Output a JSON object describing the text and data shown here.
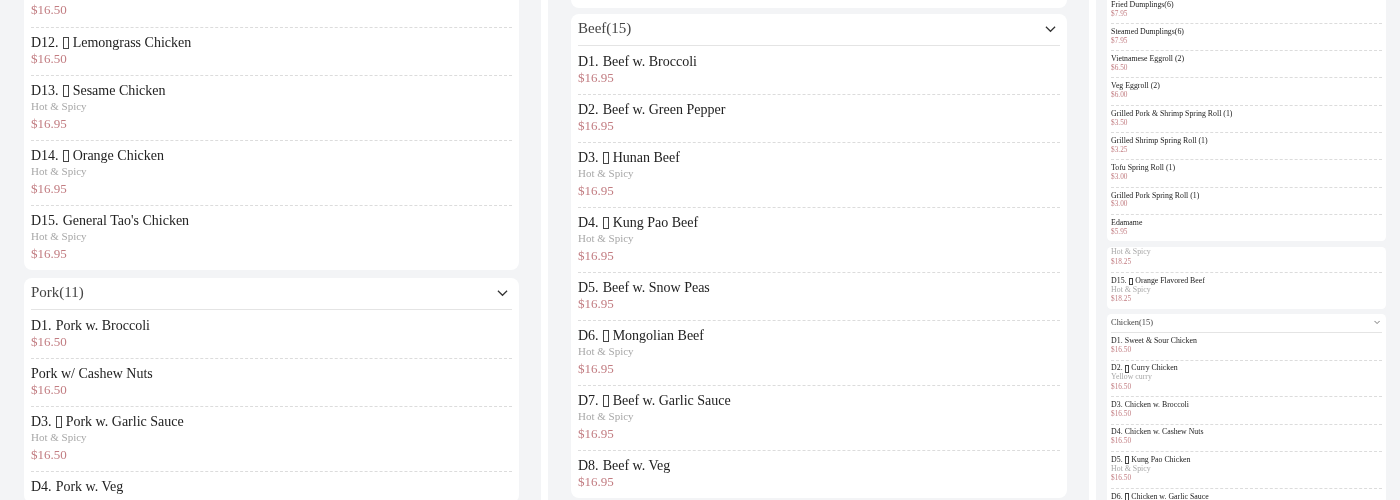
{
  "columns": [
    {
      "kind": "full",
      "sections": [
        {
          "kind": "continued",
          "items": [
            {
              "price": "$16.50"
            },
            {
              "code": "D12.",
              "icon": true,
              "name": "Lemongrass Chicken",
              "price": "$16.50"
            },
            {
              "code": "D13.",
              "icon": true,
              "name": "Sesame Chicken",
              "note": "Hot & Spicy",
              "price": "$16.95"
            },
            {
              "code": "D14.",
              "icon": true,
              "name": "Orange Chicken",
              "note": "Hot & Spicy",
              "price": "$16.95"
            },
            {
              "code": "D15.",
              "name": "General Tao's Chicken",
              "note": "Hot & Spicy",
              "price": "$16.95"
            }
          ]
        },
        {
          "kind": "category",
          "title": "Pork(11)",
          "items": [
            {
              "code": "D1.",
              "name": "Pork w. Broccoli",
              "price": "$16.50"
            },
            {
              "name": "Pork w/ Cashew Nuts",
              "price": "$16.50"
            },
            {
              "code": "D3.",
              "icon": true,
              "name": "Pork w. Garlic Sauce",
              "note": "Hot & Spicy",
              "price": "$16.50"
            },
            {
              "code": "D4.",
              "name": "Pork w. Veg"
            }
          ]
        }
      ]
    },
    {
      "kind": "full",
      "sections": [
        {
          "kind": "stub"
        },
        {
          "kind": "category",
          "title": "Beef(15)",
          "items": [
            {
              "code": "D1.",
              "name": "Beef w. Broccoli",
              "price": "$16.95"
            },
            {
              "code": "D2.",
              "name": "Beef w. Green Pepper",
              "price": "$16.95"
            },
            {
              "code": "D3.",
              "icon": true,
              "name": "Hunan Beef",
              "note": "Hot & Spicy",
              "price": "$16.95"
            },
            {
              "code": "D4.",
              "icon": true,
              "name": "Kung Pao Beef",
              "note": "Hot & Spicy",
              "price": "$16.95"
            },
            {
              "code": "D5.",
              "name": "Beef w. Snow Peas",
              "price": "$16.95"
            },
            {
              "code": "D6.",
              "icon": true,
              "name": "Mongolian Beef",
              "note": "Hot & Spicy",
              "price": "$16.95"
            },
            {
              "code": "D7.",
              "icon": true,
              "name": "Beef w. Garlic Sauce",
              "note": "Hot & Spicy",
              "price": "$16.95"
            },
            {
              "code": "D8.",
              "name": "Beef w. Veg",
              "price": "$16.95"
            }
          ]
        }
      ]
    },
    {
      "kind": "compact",
      "sections": [
        {
          "kind": "continued",
          "items": [
            {
              "name": "Fried Dumplings(6)",
              "price": "$7.95"
            },
            {
              "name": "Steamed Dumplings(6)",
              "price": "$7.95"
            },
            {
              "name": "Vietnamese Eggroll (2)",
              "price": "$6.50"
            },
            {
              "name": "Veg Eggroll (2)",
              "price": "$6.00"
            },
            {
              "name": "Grilled Pork & Shrimp Spring Roll (1)",
              "price": "$3.50"
            },
            {
              "name": "Grilled Shrimp Spring Roll (1)",
              "price": "$3.25"
            },
            {
              "name": "Tofu Spring Roll (1)",
              "price": "$3.00"
            },
            {
              "name": "Grilled Pork Spring Roll (1)",
              "price": "$3.00"
            },
            {
              "name": "Edamame",
              "price": "$5.95"
            }
          ]
        },
        {
          "kind": "continued",
          "items": [
            {
              "note": "Hot & Spicy",
              "price": "$18.25"
            },
            {
              "code": "D15.",
              "icon": true,
              "name": "Orange Flavored Beef",
              "note": "Hot & Spicy",
              "price": "$18.25"
            }
          ]
        },
        {
          "kind": "category",
          "title": "Chicken(15)",
          "items": [
            {
              "code": "D1.",
              "name": "Sweet & Sour Chicken",
              "price": "$16.50"
            },
            {
              "code": "D2.",
              "icon": true,
              "name": "Curry Chicken",
              "note": "Yellow curry",
              "price": "$16.50"
            },
            {
              "code": "D3.",
              "name": "Chicken w. Broccoli",
              "price": "$16.50"
            },
            {
              "code": "D4.",
              "name": "Chicken w. Cashew Nuts",
              "price": "$16.50"
            },
            {
              "code": "D5.",
              "icon": true,
              "name": "Kung Pao Chicken",
              "note": "Hot & Spicy",
              "price": "$16.50"
            },
            {
              "code": "D6.",
              "icon": true,
              "name": "Chicken w. Garlic Sauce"
            }
          ]
        }
      ]
    }
  ]
}
